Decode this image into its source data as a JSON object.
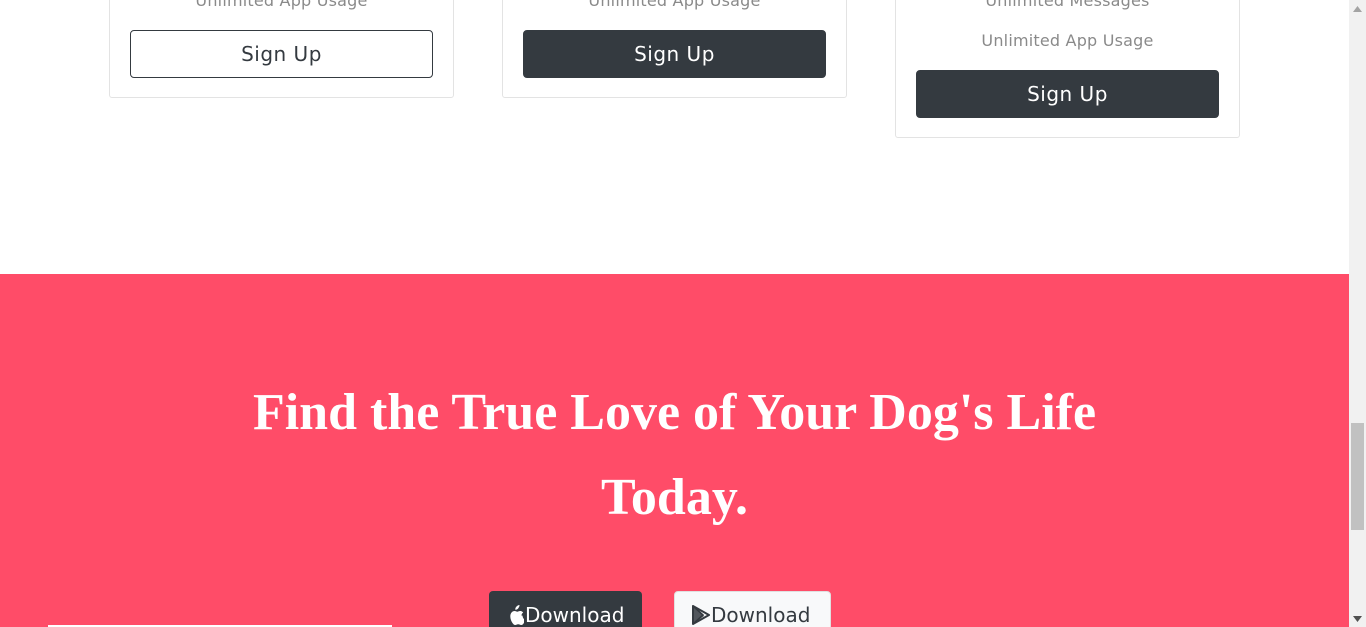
{
  "pricing_cards": [
    {
      "features": [
        "Unlimited App Usage"
      ],
      "button_label": "Sign Up",
      "button_style": "outline"
    },
    {
      "features": [
        "Unlimited App Usage"
      ],
      "button_label": "Sign Up",
      "button_style": "dark"
    },
    {
      "features": [
        "Unlimited Messages",
        "Unlimited App Usage"
      ],
      "button_label": "Sign Up",
      "button_style": "dark"
    }
  ],
  "cta": {
    "heading": "Find the True Love of Your Dog's Life Today.",
    "apple_button_label": "Download",
    "play_button_label": "Download",
    "apple_icon": "apple-icon",
    "play_icon": "google-play-icon"
  },
  "colors": {
    "cta_background": "#ff4c68",
    "dark_button": "#343a40",
    "light_button": "#f8f9fa"
  }
}
